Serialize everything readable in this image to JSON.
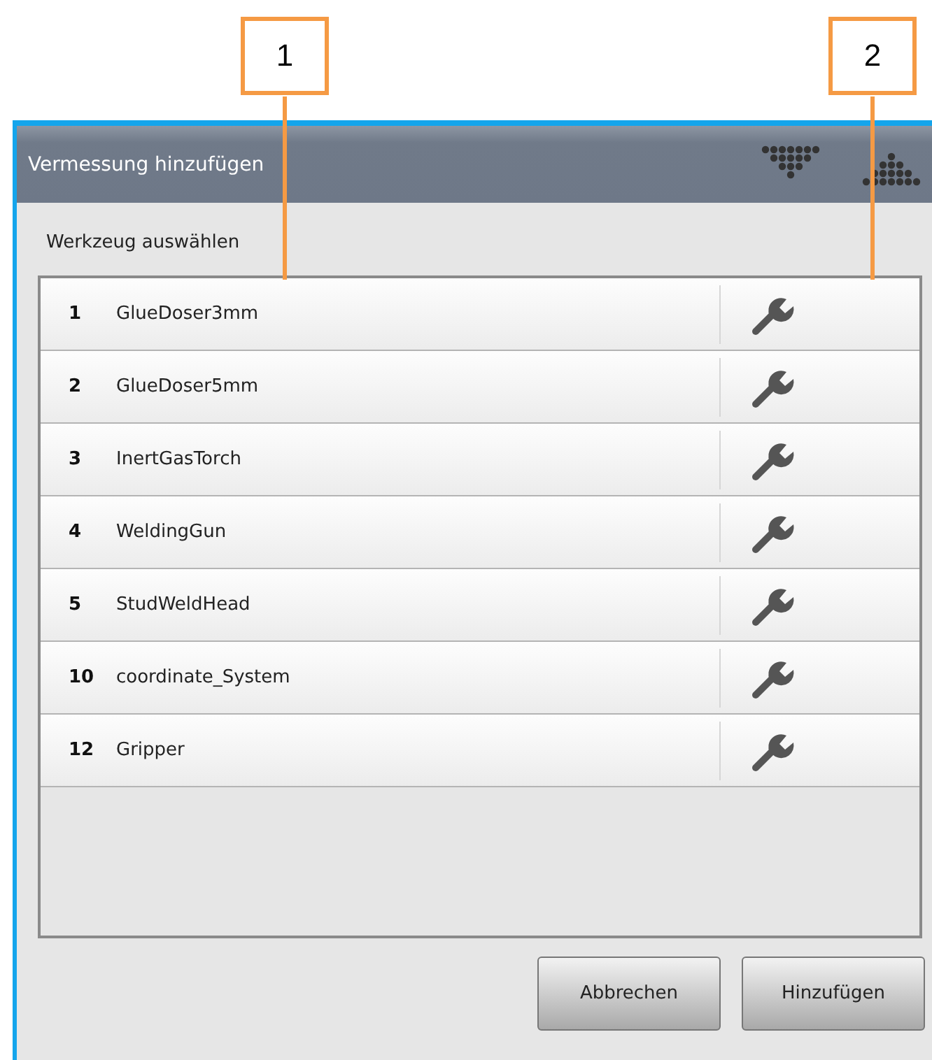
{
  "callouts": [
    {
      "label": "1"
    },
    {
      "label": "2"
    }
  ],
  "dialog": {
    "title": "Vermessung hinzufügen",
    "section_label": "Werkzeug auswählen",
    "tools": [
      {
        "number": "1",
        "name": "GlueDoser3mm"
      },
      {
        "number": "2",
        "name": "GlueDoser5mm"
      },
      {
        "number": "3",
        "name": "InertGasTorch"
      },
      {
        "number": "4",
        "name": "WeldingGun"
      },
      {
        "number": "5",
        "name": "StudWeldHead"
      },
      {
        "number": "10",
        "name": "coordinate_System"
      },
      {
        "number": "12",
        "name": "Gripper"
      }
    ],
    "buttons": [
      {
        "label": "Abbrechen"
      },
      {
        "label": "Hinzufügen"
      }
    ]
  }
}
